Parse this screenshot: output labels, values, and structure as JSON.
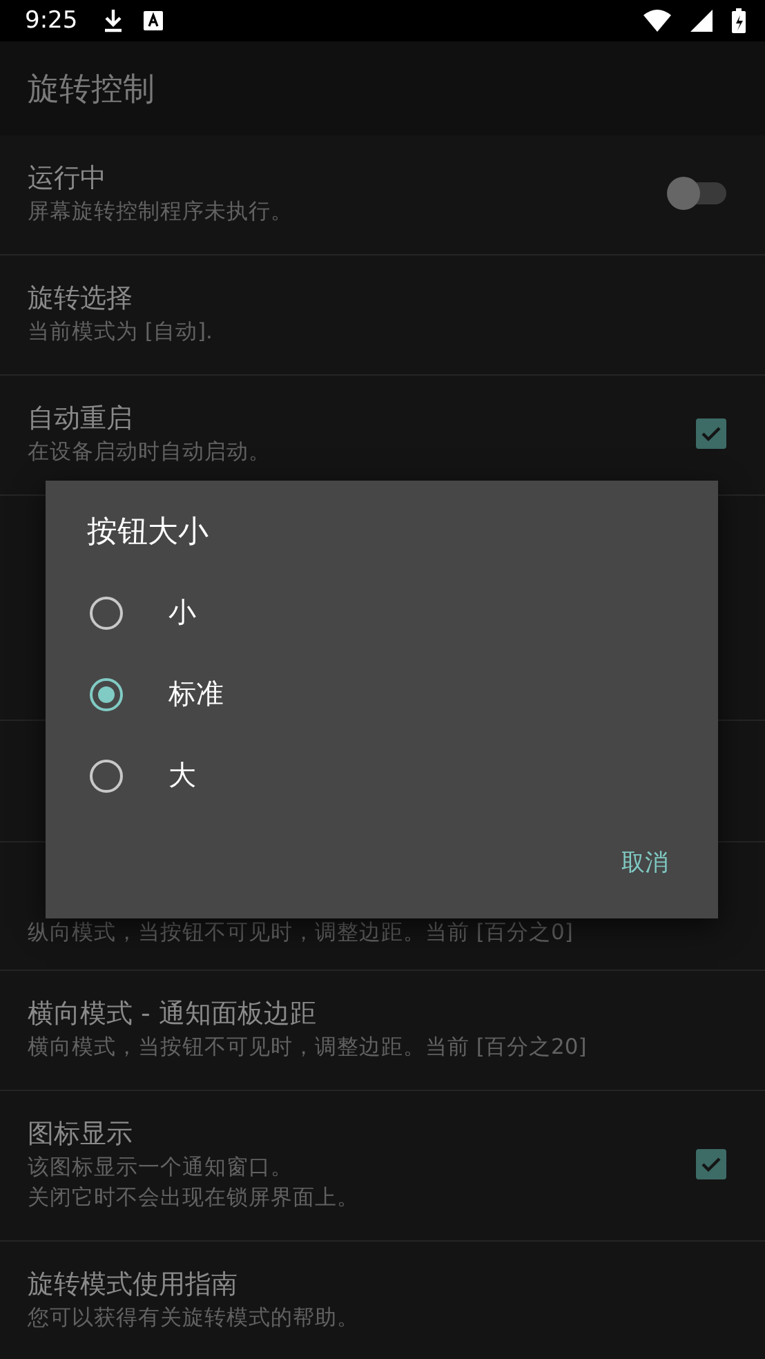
{
  "status_bar": {
    "time": "9:25"
  },
  "toolbar": {
    "title": "旋转控制"
  },
  "settings": [
    {
      "kind": "switch",
      "title": "运行中",
      "lines": [
        "屏幕旋转控制程序未执行。"
      ],
      "on": false
    },
    {
      "kind": "plain",
      "title": "旋转选择",
      "lines": [
        "当前模式为 [自动]."
      ]
    },
    {
      "kind": "checkbox",
      "title": "自动重启",
      "lines": [
        "在设备启动时自动启动。"
      ],
      "checked": true
    }
  ],
  "settings_below": [
    {
      "kind": "plain",
      "lines": [
        "纵向模式，当按钮不可见时，调整边距。当前 [百分之0]"
      ]
    },
    {
      "kind": "plain",
      "title": "横向模式 - 通知面板边距",
      "lines": [
        "横向模式，当按钮不可见时，调整边距。当前 [百分之20]"
      ]
    },
    {
      "kind": "checkbox",
      "title": "图标显示",
      "lines": [
        "该图标显示一个通知窗口。",
        "关闭它时不会出现在锁屏界面上。"
      ],
      "checked": true
    },
    {
      "kind": "plain",
      "title": "旋转模式使用指南",
      "lines": [
        "您可以获得有关旋转模式的帮助。"
      ]
    }
  ],
  "dialog": {
    "title": "按钮大小",
    "options": [
      {
        "label": "小",
        "selected": false
      },
      {
        "label": "标准",
        "selected": true
      },
      {
        "label": "大",
        "selected": false
      }
    ],
    "buttons": [
      "取消"
    ]
  }
}
